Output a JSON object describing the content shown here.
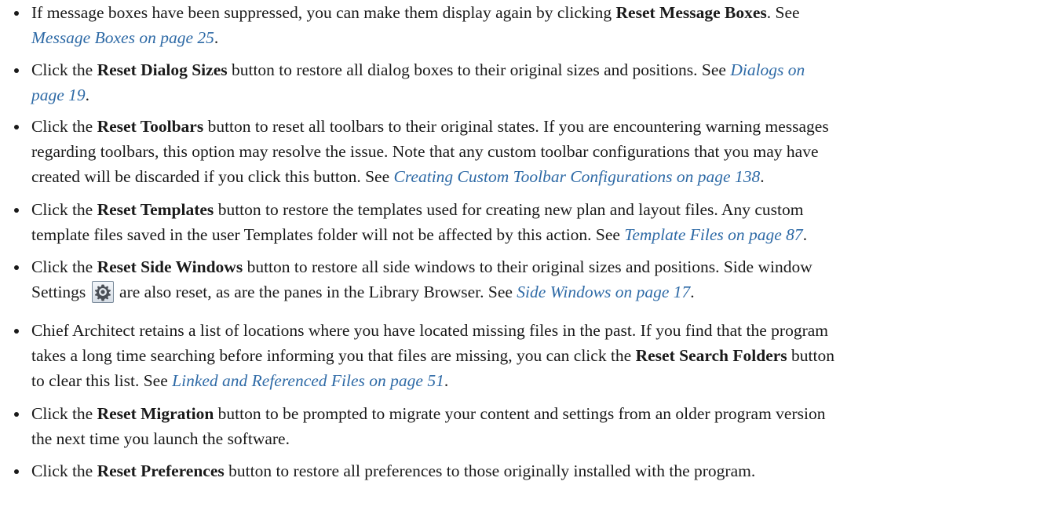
{
  "items": [
    {
      "l1": [
        "If message boxes have been suppressed, you can make them display again by clicking ",
        "Reset Message Boxes",
        ". See"
      ],
      "l2": [
        "Message Boxes on page 25",
        "."
      ]
    },
    {
      "l1": [
        "Click the ",
        "Reset Dialog Sizes",
        " button to restore all dialog boxes to their original sizes and positions. See ",
        "Dialogs on"
      ],
      "l2": [
        "page 19",
        "."
      ]
    },
    {
      "l1": [
        "Click the ",
        "Reset Toolbars",
        " button to reset all toolbars to their original states. If you are encountering warning messages"
      ],
      "l2": "regarding toolbars, this option may resolve the issue. Note that any custom toolbar configurations that you may have",
      "l3": [
        "created will be discarded if you click this button. See ",
        "Creating Custom Toolbar Configurations on page 138",
        "."
      ]
    },
    {
      "l1": [
        "Click the ",
        "Reset Templates",
        " button to restore the templates used for creating new plan and layout files. Any custom"
      ],
      "l2": [
        "template files saved in the user Templates folder will not be affected by this action. See ",
        "Template Files on page 87",
        "."
      ]
    },
    {
      "l1": [
        "Click the ",
        "Reset Side Windows",
        " button to restore all side windows to their original sizes and positions. Side window"
      ],
      "l2": [
        "Settings",
        " are also reset, as are the panes in the Library Browser. See ",
        "Side Windows on page 17",
        "."
      ],
      "gear_icon": "gear-icon"
    },
    {
      "l1": "Chief Architect retains a list of locations where you have located missing files in the past. If you find that the program",
      "l2": [
        "takes a long time searching before informing you that files are missing, you can click the ",
        "Reset Search Folders",
        " button"
      ],
      "l3": [
        "to clear this list. See ",
        "Linked and Referenced Files on page 51",
        "."
      ]
    },
    {
      "l1": [
        "Click the ",
        "Reset Migration",
        " button to be prompted to migrate your content and settings from an older program version"
      ],
      "l2": "the next time you launch the software."
    },
    {
      "l1": [
        "Click the ",
        "Reset Preferences",
        " button to restore all preferences to those originally installed with the program."
      ]
    }
  ],
  "colors": {
    "text": "#1a1a1a",
    "link": "#2e6aa6"
  }
}
